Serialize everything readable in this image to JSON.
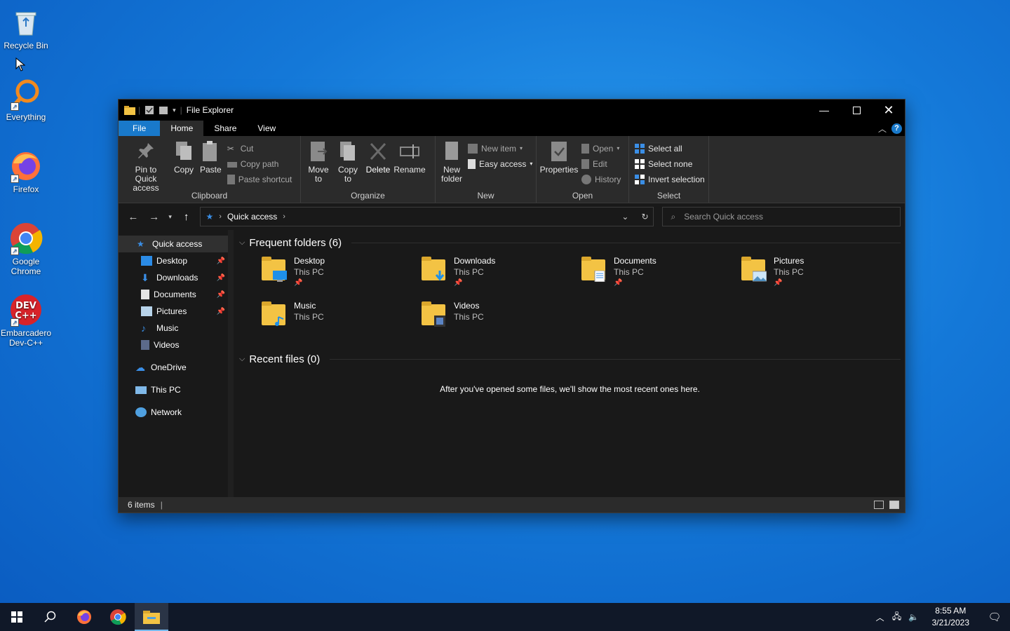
{
  "desktop": {
    "icons": [
      {
        "label": "Recycle Bin"
      },
      {
        "label": "Everything"
      },
      {
        "label": "Firefox"
      },
      {
        "label": "Google Chrome"
      },
      {
        "label": "Embarcadero Dev-C++"
      }
    ]
  },
  "window": {
    "title": "File Explorer",
    "tabs": [
      "File",
      "Home",
      "Share",
      "View"
    ],
    "help": "?",
    "ribbon": {
      "clipboard": {
        "label": "Clipboard",
        "pin": "Pin to Quick access",
        "copy": "Copy",
        "paste": "Paste",
        "cut": "Cut",
        "copy_path": "Copy path",
        "paste_shortcut": "Paste shortcut"
      },
      "organize": {
        "label": "Organize",
        "move_to": "Move to",
        "copy_to": "Copy to",
        "delete": "Delete",
        "rename": "Rename"
      },
      "new": {
        "label": "New",
        "new_folder": "New folder",
        "new_item": "New item",
        "easy_access": "Easy access"
      },
      "open": {
        "label": "Open",
        "properties": "Properties",
        "open": "Open",
        "edit": "Edit",
        "history": "History"
      },
      "select": {
        "label": "Select",
        "select_all": "Select all",
        "select_none": "Select none",
        "invert": "Invert selection"
      }
    },
    "address": {
      "crumb": "Quick access",
      "search_placeholder": "Search Quick access"
    },
    "nav": {
      "quick_access": "Quick access",
      "pinned": [
        "Desktop",
        "Downloads",
        "Documents",
        "Pictures",
        "Music",
        "Videos"
      ],
      "onedrive": "OneDrive",
      "this_pc": "This PC",
      "network": "Network"
    },
    "content": {
      "frequent_header": "Frequent folders (6)",
      "folders": [
        {
          "name": "Desktop",
          "location": "This PC",
          "pinned": true
        },
        {
          "name": "Downloads",
          "location": "This PC",
          "pinned": true
        },
        {
          "name": "Documents",
          "location": "This PC",
          "pinned": true
        },
        {
          "name": "Pictures",
          "location": "This PC",
          "pinned": true
        },
        {
          "name": "Music",
          "location": "This PC",
          "pinned": false
        },
        {
          "name": "Videos",
          "location": "This PC",
          "pinned": false
        }
      ],
      "recent_header": "Recent files (0)",
      "recent_empty": "After you've opened some files, we'll show the most recent ones here."
    },
    "status": {
      "items": "6 items"
    }
  },
  "taskbar": {
    "time": "8:55 AM",
    "date": "3/21/2023"
  },
  "colors": {
    "accent": "#1979ca",
    "folder": "#f3c344",
    "window_bg": "#191919",
    "ribbon_bg": "#2b2b2b"
  }
}
